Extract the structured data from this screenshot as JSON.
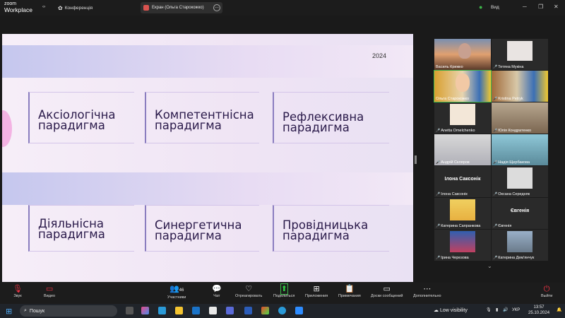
{
  "app": {
    "logo_line1": "zoom",
    "logo_line2": "Workplace",
    "conference_label": "Конференція"
  },
  "share": {
    "label": "Екран (Ольга Старокожко)"
  },
  "view": {
    "label": "Вид"
  },
  "slide": {
    "year": "2024",
    "boxes": [
      {
        "line1": "Аксіологічна",
        "line2": "парадигма"
      },
      {
        "line1": "Компетентнісна",
        "line2": "парадигма"
      },
      {
        "line1": "Рефлексивна",
        "line2": "парадигма"
      },
      {
        "line1": "Діяльнісна",
        "line2": "парадигма"
      },
      {
        "line1": "Синергетична",
        "line2": "парадигма"
      },
      {
        "line1": "Провідницька",
        "line2": "парадигма"
      }
    ]
  },
  "participants": [
    {
      "name": "Василь Крижко",
      "muted": false
    },
    {
      "name": "Тетяна Мукіна",
      "muted": true
    },
    {
      "name": "Ольга Старокожко",
      "muted": false
    },
    {
      "name": "Kristina Petryk",
      "muted": true
    },
    {
      "name": "Anetta Omelchenko",
      "muted": true
    },
    {
      "name": "Юлія Кондратенко",
      "muted": true
    },
    {
      "name": "Андрій Скляров",
      "muted": true
    },
    {
      "name": "Надія Щербакова",
      "muted": true
    },
    {
      "name": "Ілона Саксонік",
      "muted": true,
      "big": "Ілона Саксонік"
    },
    {
      "name": "Оксана Середняк",
      "muted": true
    },
    {
      "name": "Катерина Сапранкова",
      "muted": true
    },
    {
      "name": "Євгенія",
      "muted": true,
      "big": "Євгенія"
    },
    {
      "name": "Ірина Черезова",
      "muted": true
    },
    {
      "name": "Катерина Дем'янчук",
      "muted": true
    }
  ],
  "toolbar": {
    "audio": "Звук",
    "video": "Видео",
    "participants": "Участники",
    "participants_count": "46",
    "chat": "Чат",
    "react": "Отреагировать",
    "share": "Поделиться",
    "apps": "Приложения",
    "notes": "Примечания",
    "whiteboards": "Доски сообщений",
    "more": "Дополнительно",
    "leave": "Выйти"
  },
  "taskbar": {
    "search": "Пошук",
    "low_visibility": "Low visibility",
    "lang": "УКР",
    "time": "13:57",
    "date": "25.10.2024"
  },
  "colors": {
    "slide_text": "#2a1a4a",
    "muted_mic": "#e34",
    "active_border": "#3db54a"
  }
}
